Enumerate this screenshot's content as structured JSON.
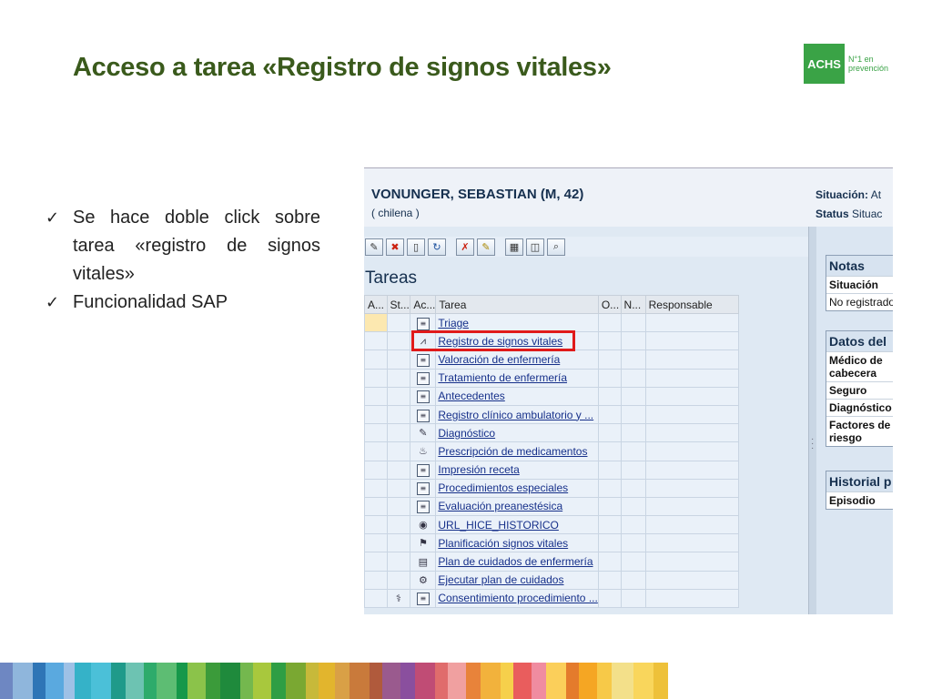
{
  "slide": {
    "title": "Acceso a tarea «Registro de signos vitales»",
    "logo": {
      "name": "ACHS",
      "tagline_1": "N°1 en",
      "tagline_2": "prevención"
    },
    "bullets": [
      "Se hace doble click sobre tarea «registro de signos vitales»",
      "Funcionalidad SAP"
    ]
  },
  "sap": {
    "patient_name": "VONUNGER, SEBASTIAN (M, 42)",
    "nationality": "( chilena )",
    "header": {
      "situacion_label": "Situación:",
      "situacion_value": "At",
      "status_label": "Status",
      "status_value": "Situac"
    },
    "tasks_title": "Tareas",
    "columns": [
      "A...",
      "St...",
      "Ac...",
      "Tarea",
      "O...",
      "N...",
      "Responsable"
    ],
    "tasks": [
      {
        "label": "Triage",
        "icon": "doc-icon"
      },
      {
        "label": "Registro de signos vitales",
        "icon": "chart-icon"
      },
      {
        "label": "Valoración de enfermería",
        "icon": "doc-icon"
      },
      {
        "label": "Tratamiento de enfermería",
        "icon": "doc-icon"
      },
      {
        "label": "Antecedentes",
        "icon": "doc-icon"
      },
      {
        "label": "Registro clínico ambulatorio y ...",
        "icon": "doc-icon"
      },
      {
        "label": "Diagnóstico",
        "icon": "pencil-icon"
      },
      {
        "label": "Prescripción de medicamentos",
        "icon": "pills-icon"
      },
      {
        "label": "Impresión receta",
        "icon": "doc-icon"
      },
      {
        "label": "Procedimientos especiales",
        "icon": "doc-icon"
      },
      {
        "label": "Evaluación preanestésica",
        "icon": "doc-icon"
      },
      {
        "label": "URL_HICE_HISTORICO",
        "icon": "globe-icon"
      },
      {
        "label": "Planificación signos vitales",
        "icon": "plan-icon"
      },
      {
        "label": "Plan de cuidados de enfermería",
        "icon": "calendar-icon"
      },
      {
        "label": "Ejecutar plan de cuidados",
        "icon": "execute-icon"
      },
      {
        "label": "Consentimiento procedimiento ...",
        "icon": "doc-icon"
      }
    ],
    "right_panel": {
      "notas_title": "Notas",
      "notas_col": "Situación",
      "notas_value": "No registrado",
      "datos_title": "Datos del",
      "datos_rows": [
        "Médico de cabecera",
        "Seguro",
        "Diagnóstico",
        "Factores de riesgo"
      ],
      "historial_title": "Historial p",
      "historial_row": "Episodio"
    }
  },
  "colors": {
    "title_green": "#3a5a1c",
    "brand_green": "#3aa346",
    "highlight_red": "#e01a1a"
  }
}
